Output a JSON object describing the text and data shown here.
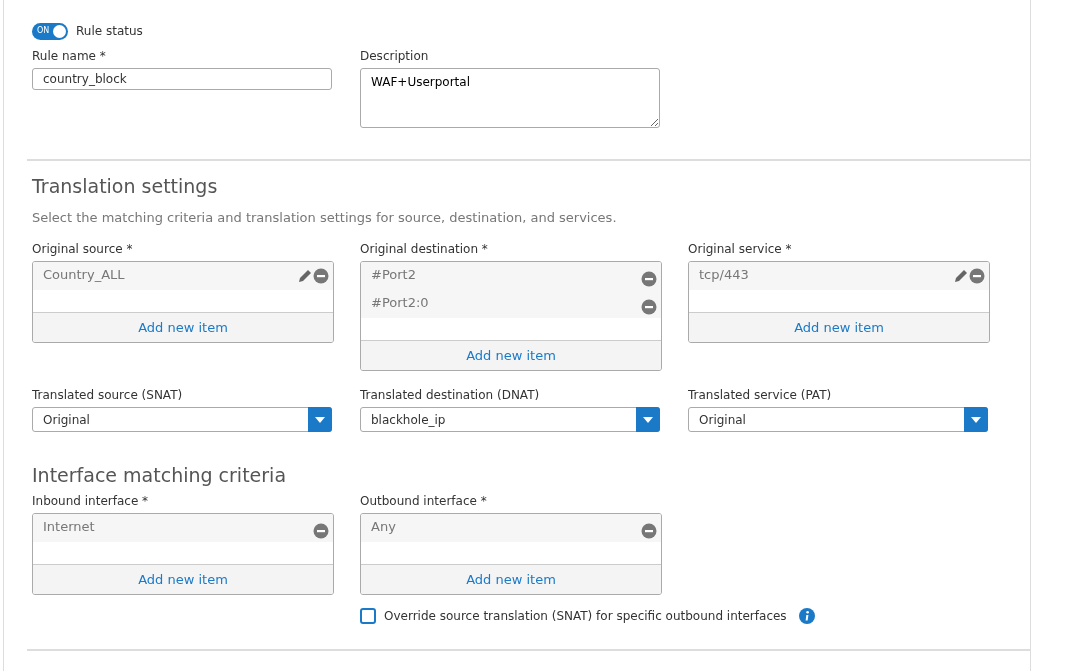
{
  "rule_status": {
    "toggle_text": "ON",
    "on": true,
    "label": "Rule status"
  },
  "rule_name": {
    "label": "Rule name *",
    "value": "country_block"
  },
  "description": {
    "label": "Description",
    "value": "WAF+Userportal"
  },
  "translation": {
    "heading": "Translation settings",
    "subtitle": "Select the matching criteria and translation settings for source, destination, and services.",
    "lists": [
      {
        "label": "Original source *",
        "items": [
          {
            "text": "Country_ALL",
            "editable": true
          }
        ],
        "add_text": "Add new item"
      },
      {
        "label": "Original destination *",
        "items": [
          {
            "text": "#Port2",
            "editable": false
          },
          {
            "text": "#Port2:0",
            "editable": false
          }
        ],
        "add_text": "Add new item"
      },
      {
        "label": "Original service *",
        "items": [
          {
            "text": "tcp/443",
            "editable": true
          }
        ],
        "add_text": "Add new item"
      }
    ],
    "selects": [
      {
        "label": "Translated source (SNAT)",
        "value": "Original"
      },
      {
        "label": "Translated destination (DNAT)",
        "value": "blackhole_ip"
      },
      {
        "label": "Translated service (PAT)",
        "value": "Original"
      }
    ]
  },
  "interface": {
    "heading": "Interface matching criteria",
    "lists": [
      {
        "label": "Inbound interface *",
        "items": [
          {
            "text": "Internet",
            "editable": false
          }
        ],
        "add_text": "Add new item"
      },
      {
        "label": "Outbound interface *",
        "items": [
          {
            "text": "Any",
            "editable": false
          }
        ],
        "add_text": "Add new item"
      }
    ],
    "override": {
      "label": "Override source translation (SNAT) for specific outbound interfaces",
      "checked": false
    }
  }
}
